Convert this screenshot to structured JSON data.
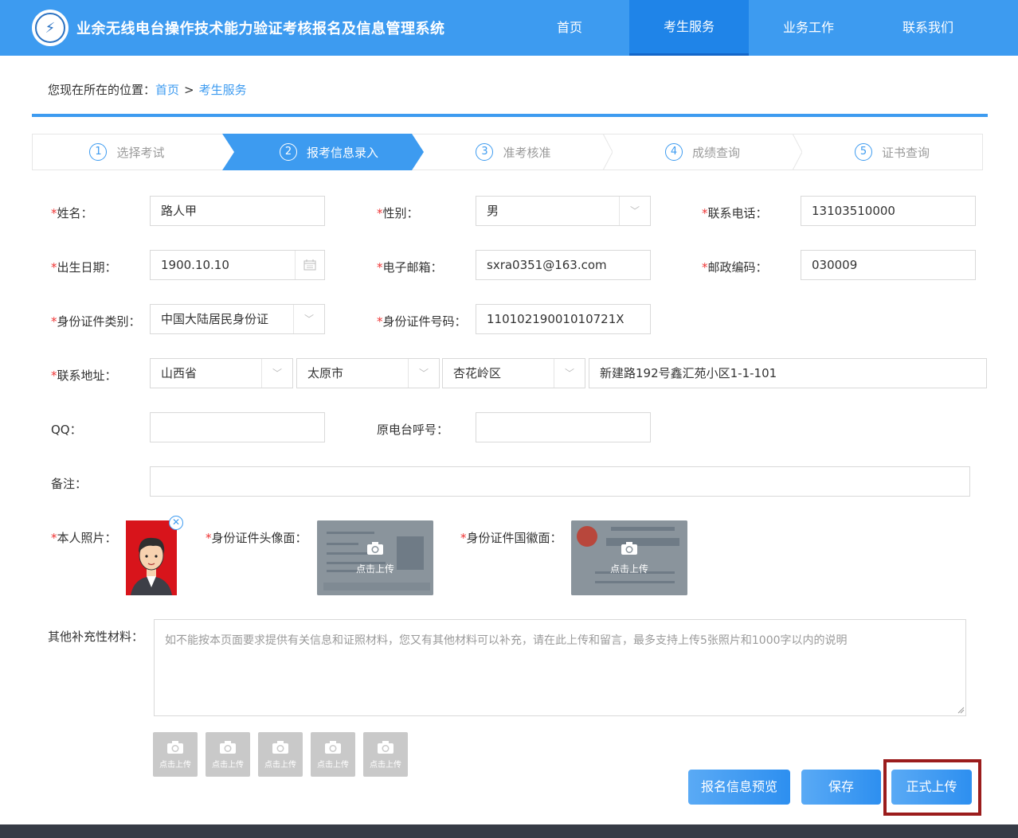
{
  "header": {
    "site_title": "业余无线电台操作技术能力验证考核报名及信息管理系统",
    "nav": [
      "首页",
      "考生服务",
      "业务工作",
      "联系我们"
    ],
    "active_nav": "考生服务"
  },
  "breadcrumb": {
    "prefix": "您现在所在的位置：",
    "home": "首页",
    "separator": ">",
    "current": "考生服务"
  },
  "steps": [
    {
      "num": "1",
      "label": "选择考试"
    },
    {
      "num": "2",
      "label": "报考信息录入"
    },
    {
      "num": "3",
      "label": "准考核准"
    },
    {
      "num": "4",
      "label": "成绩查询"
    },
    {
      "num": "5",
      "label": "证书查询"
    }
  ],
  "form": {
    "name": {
      "label": "姓名：",
      "value": "路人甲"
    },
    "gender": {
      "label": "性别：",
      "value": "男"
    },
    "phone": {
      "label": "联系电话：",
      "value": "13103510000"
    },
    "birth": {
      "label": "出生日期：",
      "value": "1900.10.10"
    },
    "email": {
      "label": "电子邮箱：",
      "value": "sxra0351@163.com"
    },
    "postcode": {
      "label": "邮政编码：",
      "value": "030009"
    },
    "id_type": {
      "label": "身份证件类别：",
      "value": "中国大陆居民身份证"
    },
    "id_number": {
      "label": "身份证件号码：",
      "value": "11010219001010721X"
    },
    "address": {
      "label": "联系地址：",
      "province": "山西省",
      "city": "太原市",
      "district": "杏花岭区",
      "detail": "新建路192号鑫汇苑小区1-1-101"
    },
    "qq": {
      "label": "QQ：",
      "value": ""
    },
    "callsign": {
      "label": "原电台呼号：",
      "value": ""
    },
    "remark": {
      "label": "备注：",
      "value": ""
    },
    "photo": {
      "label": "本人照片："
    },
    "id_front": {
      "label": "身份证件头像面：",
      "upload": "点击上传"
    },
    "id_back": {
      "label": "身份证件国徽面：",
      "upload": "点击上传"
    },
    "other": {
      "label": "其他补充性材料：",
      "placeholder": "如不能按本页面要求提供有关信息和证照材料，您又有其他材料可以补充，请在此上传和留言，最多支持上传5张照片和1000字以内的说明"
    },
    "small_upload_label": "点击上传"
  },
  "buttons": {
    "preview": "报名信息预览",
    "save": "保存",
    "submit": "正式上传"
  },
  "colors": {
    "primary": "#3d9bf0",
    "highlight_box": "#9b1c1c",
    "required": "#e33333"
  }
}
